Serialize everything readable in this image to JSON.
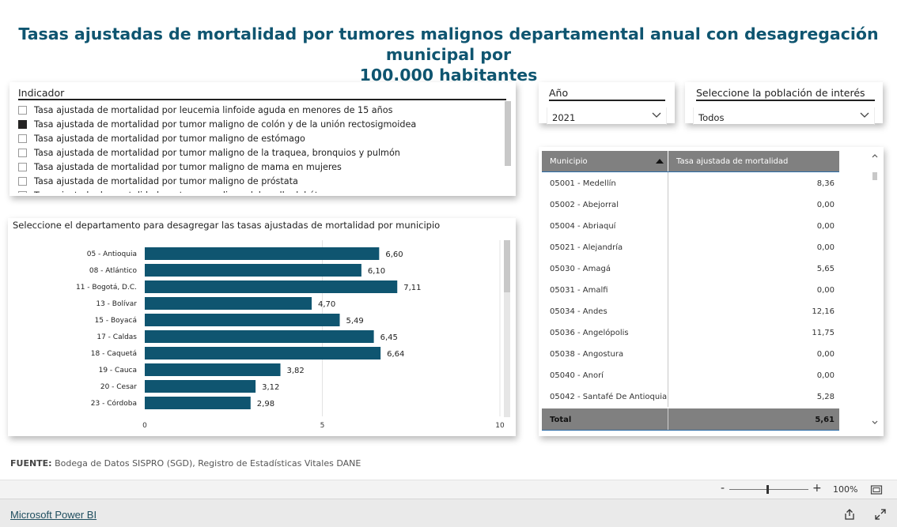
{
  "header": {
    "title_line1": "Tasas ajustadas de mortalidad por tumores malignos departamental anual con desagregación municipal por",
    "title_line2": "100.000 habitantes"
  },
  "indicator_slicer": {
    "title": "Indicador",
    "items": [
      {
        "label": "Tasa ajustada de mortalidad por leucemia linfoide aguda en menores de 15 años",
        "checked": false
      },
      {
        "label": "Tasa ajustada de mortalidad por tumor maligno de colón y de la unión rectosigmoidea",
        "checked": true
      },
      {
        "label": "Tasa ajustada de mortalidad por tumor maligno de estómago",
        "checked": false
      },
      {
        "label": "Tasa ajustada de mortalidad por tumor maligno de la traquea, bronquios y pulmón",
        "checked": false
      },
      {
        "label": "Tasa ajustada de mortalidad por tumor maligno de mama en mujeres",
        "checked": false
      },
      {
        "label": "Tasa ajustada de mortalidad por tumor maligno de próstata",
        "checked": false
      },
      {
        "label": "Tasa ajustada de mortalidad por tumor maligno del cuello del útero",
        "checked": false
      }
    ]
  },
  "year_slicer": {
    "title": "Año",
    "selected": "2021"
  },
  "population_slicer": {
    "title": "Seleccione la población de interés",
    "selected": "Todos"
  },
  "chart_data": {
    "type": "bar",
    "orientation": "horizontal",
    "title": "Seleccione el departamento para desagregar las tasas ajustadas de mortalidad por municipio",
    "categories": [
      "05 - Antioquia",
      "08 - Atlántico",
      "11 - Bogotá, D.C.",
      "13 - Bolívar",
      "15 - Boyacá",
      "17 - Caldas",
      "18 - Caquetá",
      "19 - Cauca",
      "20 - Cesar",
      "23 - Córdoba"
    ],
    "values": [
      6.6,
      6.1,
      7.11,
      4.7,
      5.49,
      6.45,
      6.64,
      3.82,
      3.12,
      2.98
    ],
    "value_labels": [
      "6,60",
      "6,10",
      "7,11",
      "4,70",
      "5,49",
      "6,45",
      "6,64",
      "3,82",
      "3,12",
      "2,98"
    ],
    "xlim": [
      0,
      10
    ],
    "xticks": [
      "0",
      "5",
      "10"
    ],
    "bar_color": "#0f5570",
    "grid": true
  },
  "table": {
    "columns": [
      "Municipio",
      "Tasa ajustada de mortalidad"
    ],
    "rows": [
      [
        "05001 - Medellín",
        "8,36"
      ],
      [
        "05002 - Abejorral",
        "0,00"
      ],
      [
        "05004 - Abriaquí",
        "0,00"
      ],
      [
        "05021 - Alejandría",
        "0,00"
      ],
      [
        "05030 - Amagá",
        "5,65"
      ],
      [
        "05031 - Amalfi",
        "0,00"
      ],
      [
        "05034 - Andes",
        "12,16"
      ],
      [
        "05036 - Angelópolis",
        "11,75"
      ],
      [
        "05038 - Angostura",
        "0,00"
      ],
      [
        "05040 - Anorí",
        "0,00"
      ],
      [
        "05042 - Santafé De Antioquia",
        "5,28"
      ]
    ],
    "total_label": "Total",
    "total_value": "5,61"
  },
  "source": {
    "label": "FUENTE:",
    "text": " Bodega de Datos SISPRO (SGD), Registro de Estadísticas Vitales DANE"
  },
  "zoom": {
    "minus": "-",
    "plus": "+",
    "level": "100%"
  },
  "footer": {
    "brand": "Microsoft Power BI"
  },
  "colors": {
    "title": "#0f5570",
    "bar": "#0f5570",
    "header_gray": "#808080"
  }
}
